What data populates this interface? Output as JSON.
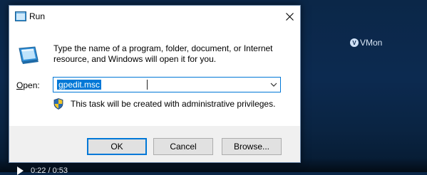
{
  "dialog": {
    "title": "Run",
    "description": "Type the name of a program, folder, document, or Internet resource, and Windows will open it for you.",
    "open_label_accel": "O",
    "open_label_rest": "pen:",
    "input_value": "gpedit.msc",
    "admin_note": "This task will be created with administrative privileges.",
    "buttons": {
      "ok": "OK",
      "cancel": "Cancel",
      "browse": "Browse..."
    }
  },
  "watermark": {
    "text": "VMon"
  },
  "player": {
    "time": "0:22 / 0:53"
  },
  "icons": {
    "title": "run-icon",
    "close": "close-icon",
    "big": "run-app-icon",
    "dropdown": "chevron-down-icon",
    "shield": "uac-shield-icon"
  },
  "colors": {
    "accent": "#0078d7",
    "desktop": "#0c2a50",
    "footer": "#f0f0f0"
  }
}
